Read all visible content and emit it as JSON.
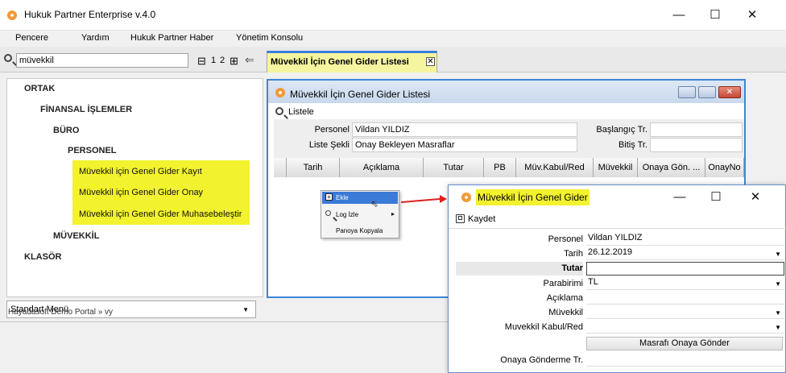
{
  "app": {
    "title": "Hukuk Partner Enterprise v.4.0"
  },
  "menu": [
    "Pencere",
    "Yardım",
    "Hukuk Partner Haber",
    "Yönetim Konsolu"
  ],
  "search": {
    "value": "müvekkil"
  },
  "pager": {
    "minus": "⊟",
    "p1": "1",
    "p2": "2",
    "plus": "⊞",
    "back": "⇐"
  },
  "tab": {
    "label": "Müvekkil İçin Genel Gider Listesi",
    "close": "✕"
  },
  "tree": {
    "ortak": "ORTAK",
    "finansal": "FİNANSAL İŞLEMLER",
    "buro": "BÜRO",
    "personel": "PERSONEL",
    "items": [
      "Müvekkil için Genel Gider Kayıt",
      "Müvekkil için Genel Gider Onay",
      "Müvekkil için Genel Gider Muhasebeleştir"
    ],
    "muvekkil": "MÜVEKKİL",
    "klasor": "KLASÖR"
  },
  "menu_select": "Standart Menü",
  "status": "Hayadasoft Demo Portal » vy",
  "inner": {
    "title": "Müvekkil İçin Genel Gider Listesi",
    "listele": "Listele",
    "personel_label": "Personel",
    "personel_value": "Vildan YILDIZ",
    "liste_label": "Liste Şekli",
    "liste_value": "Onay Bekleyen Masraflar",
    "baslangic_label": "Başlangıç Tr.",
    "bitis_label": "Bitiş Tr.",
    "columns": [
      "Tarih",
      "Açıklama",
      "Tutar",
      "PB",
      "Müv.Kabul/Red",
      "Müvekkil",
      "Onaya Gön. ...",
      "OnayNo"
    ]
  },
  "context": {
    "ekle": "Ekle",
    "log": "Log İzle",
    "pano": "Panoya Kopyala"
  },
  "dialog": {
    "title": "Müvekkil İçin Genel Gider",
    "kaydet": "Kaydet",
    "personel_label": "Personel",
    "personel_value": "Vildan YILDIZ",
    "tarih_label": "Tarih",
    "tarih_value": "26.12.2019",
    "tutar_label": "Tutar",
    "parabirimi_label": "Parabirimi",
    "parabirimi_value": "TL",
    "aciklama_label": "Açıklama",
    "muvekkil_label": "Müvekkil",
    "kabul_label": "Muvekkil Kabul/Red",
    "onaya_button": "Masrafı Onaya Gönder",
    "onaya_tr_label": "Onaya Gönderme Tr."
  },
  "colors": {
    "highlight": "#f2f22e",
    "accent": "#3f86d6",
    "arrow": "#e02020"
  }
}
